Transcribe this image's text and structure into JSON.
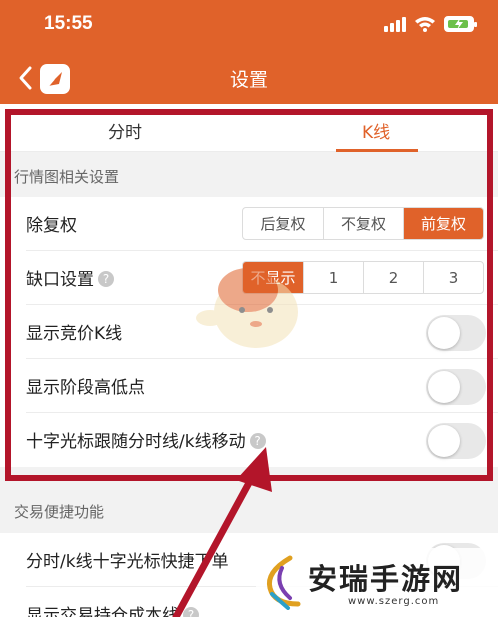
{
  "status_bar": {
    "time": "15:55"
  },
  "nav": {
    "title": "设置"
  },
  "tabs": [
    {
      "label": "分时",
      "active": false
    },
    {
      "label": "K线",
      "active": true
    }
  ],
  "sections": [
    {
      "header": "行情图相关设置",
      "rows": [
        {
          "label": "除复权",
          "options": [
            "后复权",
            "不复权",
            "前复权"
          ],
          "selected": "前复权"
        },
        {
          "label": "缺口设置",
          "options": [
            "不显示",
            "1",
            "2",
            "3"
          ],
          "selected": "不显示"
        },
        {
          "label": "显示竞价K线",
          "toggle": false
        },
        {
          "label": "显示阶段高低点",
          "toggle": false
        },
        {
          "label": "十字光标跟随分时线/k线移动",
          "toggle": false
        }
      ]
    },
    {
      "header": "交易便捷功能",
      "rows": [
        {
          "label": "分时/k线十字光标快捷下单",
          "toggle": false
        },
        {
          "label": "显示交易持仓成本线",
          "toggle": false
        }
      ]
    }
  ],
  "watermark": {
    "name": "安瑞手游网",
    "url": "www.szerg.com"
  },
  "colors": {
    "accent": "#e0622a",
    "highlight_frame": "#b3152a"
  }
}
